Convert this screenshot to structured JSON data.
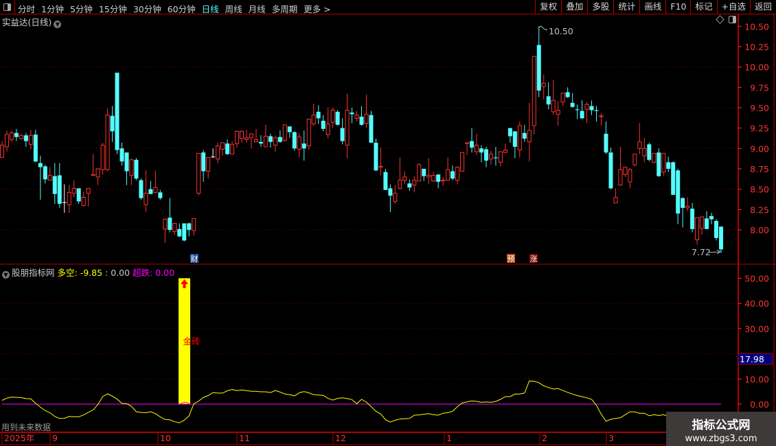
{
  "toolbar": {
    "periods": [
      "分时",
      "1分钟",
      "5分钟",
      "15分钟",
      "30分钟",
      "60分钟",
      "日线",
      "周线",
      "月线",
      "多周期",
      "更多 >"
    ],
    "active_period": "日线",
    "buttons": [
      "复权",
      "叠加",
      "多股",
      "统计",
      "画线",
      "F10",
      "标记",
      "+自选",
      "返回"
    ]
  },
  "main_pane": {
    "title": "实益达(日线)",
    "price_ticks": [
      "10.50",
      "10.25",
      "10.00",
      "9.75",
      "9.50",
      "9.25",
      "9.00",
      "8.75",
      "8.50",
      "8.25",
      "8.00"
    ],
    "high_label": "10.50",
    "low_label": "7.72",
    "markers": [
      {
        "text": "财",
        "color": "#1a4c9c"
      },
      {
        "text": "预",
        "color": "#c04a10"
      },
      {
        "text": "涨",
        "color": "#7a0000"
      }
    ]
  },
  "indicator_pane": {
    "name": "股朋指标网",
    "duokong_label": "多空",
    "duokong_value": ": -9.85",
    "duokong_value2": ": 0.00",
    "chaodie_label": "超跌",
    "chaodie_value": ": 0.00",
    "signal_label": "金砖",
    "signal_value": 50,
    "ticks": [
      "50.00",
      "40.00",
      "30.00",
      "10.00",
      "0.00"
    ],
    "current_value": "17.98",
    "future_data_note": "用到未来数据"
  },
  "date_axis": [
    "2025年",
    "9",
    "10",
    "11",
    "12",
    "1",
    "2",
    "3"
  ],
  "watermark": {
    "title": "指标公式网",
    "url": "www.zbgs3.com"
  },
  "colors": {
    "up": "#ff3232",
    "down": "#54fcfc",
    "line": "#ffff00",
    "zero": "#ff00ff",
    "signal": "#ffff00",
    "axis": "#ff3232",
    "grid": "#8b0000"
  },
  "chart_data": {
    "type": "candlestick",
    "fields": [
      "open",
      "high",
      "low",
      "close"
    ],
    "ylim": [
      7.72,
      10.5
    ],
    "candles": [
      [
        8.89,
        9.09,
        8.88,
        9.04
      ],
      [
        9.02,
        9.22,
        8.96,
        9.17
      ],
      [
        9.11,
        9.22,
        9.08,
        9.19
      ],
      [
        9.19,
        9.24,
        9.09,
        9.14
      ],
      [
        9.12,
        9.18,
        9.11,
        9.16
      ],
      [
        9.16,
        9.19,
        9.02,
        9.09
      ],
      [
        9.05,
        9.23,
        8.99,
        9.16
      ],
      [
        9.17,
        9.23,
        8.83,
        8.84
      ],
      [
        8.82,
        8.91,
        8.37,
        8.77
      ],
      [
        8.78,
        8.8,
        8.57,
        8.62
      ],
      [
        8.61,
        8.77,
        8.61,
        8.67
      ],
      [
        8.66,
        8.82,
        8.32,
        8.44
      ],
      [
        8.67,
        8.82,
        8.27,
        8.32
      ],
      [
        8.34,
        8.56,
        8.21,
        8.34
      ],
      [
        8.31,
        8.55,
        8.21,
        8.46
      ],
      [
        8.45,
        8.61,
        8.4,
        8.51
      ],
      [
        8.51,
        8.51,
        8.32,
        8.35
      ],
      [
        8.3,
        8.47,
        8.29,
        8.4
      ],
      [
        8.45,
        8.51,
        8.29,
        8.51
      ],
      [
        8.67,
        8.93,
        8.67,
        8.68
      ],
      [
        8.65,
        8.76,
        8.55,
        8.75
      ],
      [
        8.74,
        9.07,
        8.68,
        9.04
      ],
      [
        8.74,
        9.49,
        8.72,
        9.41
      ],
      [
        9.4,
        9.52,
        9.08,
        9.21
      ],
      [
        9.93,
        9.93,
        8.93,
        8.98
      ],
      [
        9.0,
        9.07,
        8.79,
        8.84
      ],
      [
        8.95,
        8.95,
        8.55,
        8.72
      ],
      [
        8.67,
        8.88,
        8.55,
        8.86
      ],
      [
        8.86,
        8.88,
        8.61,
        8.63
      ],
      [
        8.61,
        8.63,
        8.37,
        8.39
      ],
      [
        8.31,
        8.73,
        8.22,
        8.45
      ],
      [
        8.5,
        8.6,
        8.44,
        8.44
      ],
      [
        8.46,
        8.73,
        8.45,
        8.52
      ],
      [
        8.46,
        8.49,
        8.37,
        8.39
      ],
      [
        8.01,
        8.14,
        7.84,
        8.13
      ],
      [
        8.15,
        8.39,
        7.97,
        8.0
      ],
      [
        7.98,
        8.08,
        7.94,
        8.08
      ],
      [
        8.01,
        8.08,
        7.91,
        7.92
      ],
      [
        8.08,
        8.08,
        7.86,
        7.87
      ],
      [
        8.08,
        8.09,
        7.92,
        8.0
      ],
      [
        7.99,
        8.14,
        7.93,
        8.14
      ],
      [
        8.45,
        8.94,
        8.42,
        8.94
      ],
      [
        8.95,
        8.98,
        8.59,
        8.72
      ],
      [
        8.72,
        8.89,
        8.63,
        8.89
      ],
      [
        8.9,
        9.0,
        8.88,
        8.9
      ],
      [
        8.87,
        9.07,
        8.82,
        9.03
      ],
      [
        8.99,
        9.07,
        8.91,
        9.07
      ],
      [
        9.06,
        9.11,
        8.92,
        8.93
      ],
      [
        8.93,
        9.09,
        8.93,
        9.05
      ],
      [
        9.06,
        9.22,
        9.01,
        9.21
      ],
      [
        9.12,
        9.22,
        9.07,
        9.21
      ],
      [
        9.11,
        9.23,
        9.07,
        9.13
      ],
      [
        9.13,
        9.18,
        9.0,
        9.18
      ],
      [
        9.08,
        9.24,
        9.08,
        9.11
      ],
      [
        9.08,
        9.16,
        9.02,
        9.06
      ],
      [
        9.02,
        9.29,
        9.02,
        9.15
      ],
      [
        9.15,
        9.18,
        9.01,
        9.08
      ],
      [
        9.04,
        9.16,
        8.96,
        9.13
      ],
      [
        9.14,
        9.22,
        9.07,
        9.08
      ],
      [
        9.1,
        9.29,
        9.08,
        9.29
      ],
      [
        9.27,
        9.27,
        9.13,
        9.2
      ],
      [
        9.2,
        9.21,
        8.97,
        9.0
      ],
      [
        8.99,
        9.19,
        8.89,
        9.14
      ],
      [
        9.06,
        9.22,
        8.85,
        9.0
      ],
      [
        9.03,
        9.36,
        8.99,
        9.36
      ],
      [
        9.3,
        9.55,
        9.28,
        9.41
      ],
      [
        9.45,
        9.53,
        9.3,
        9.37
      ],
      [
        9.34,
        9.41,
        9.21,
        9.24
      ],
      [
        9.17,
        9.5,
        9.12,
        9.3
      ],
      [
        9.32,
        9.5,
        9.25,
        9.47
      ],
      [
        9.45,
        9.47,
        9.28,
        9.29
      ],
      [
        9.25,
        9.37,
        9.05,
        9.09
      ],
      [
        9.04,
        9.67,
        8.88,
        9.47
      ],
      [
        9.44,
        9.5,
        9.31,
        9.42
      ],
      [
        9.37,
        9.46,
        9.33,
        9.41
      ],
      [
        9.39,
        9.52,
        9.28,
        9.29
      ],
      [
        9.31,
        9.66,
        9.25,
        9.42
      ],
      [
        9.41,
        9.46,
        9.07,
        9.07
      ],
      [
        9.07,
        9.12,
        8.72,
        8.73
      ],
      [
        8.77,
        9.01,
        8.67,
        8.78
      ],
      [
        8.71,
        8.75,
        8.49,
        8.49
      ],
      [
        8.51,
        8.56,
        8.22,
        8.42
      ],
      [
        8.35,
        8.55,
        8.32,
        8.45
      ],
      [
        8.51,
        8.89,
        8.5,
        8.61
      ],
      [
        8.61,
        8.72,
        8.56,
        8.65
      ],
      [
        8.57,
        8.62,
        8.48,
        8.52
      ],
      [
        8.55,
        8.66,
        8.46,
        8.61
      ],
      [
        8.6,
        8.82,
        8.6,
        8.8
      ],
      [
        8.75,
        8.75,
        8.6,
        8.66
      ],
      [
        8.65,
        8.88,
        8.56,
        8.67
      ],
      [
        8.6,
        8.71,
        8.59,
        8.67
      ],
      [
        8.68,
        8.68,
        8.51,
        8.59
      ],
      [
        8.6,
        8.65,
        8.54,
        8.61
      ],
      [
        8.61,
        8.89,
        8.61,
        8.74
      ],
      [
        8.72,
        8.79,
        8.61,
        8.63
      ],
      [
        8.61,
        8.78,
        8.56,
        8.77
      ],
      [
        8.72,
        8.95,
        8.72,
        8.95
      ],
      [
        9.06,
        9.07,
        8.92,
        9.07
      ],
      [
        9.09,
        9.25,
        8.95,
        9.01
      ],
      [
        8.96,
        9.18,
        8.92,
        9.04
      ],
      [
        9.0,
        9.04,
        8.83,
        8.95
      ],
      [
        8.99,
        9.02,
        8.77,
        8.85
      ],
      [
        8.87,
        8.97,
        8.8,
        8.93
      ],
      [
        8.89,
        9.02,
        8.79,
        8.88
      ],
      [
        8.83,
        8.96,
        8.78,
        8.96
      ],
      [
        8.95,
        9.06,
        8.95,
        8.98
      ],
      [
        9.25,
        9.25,
        9.07,
        9.15
      ],
      [
        9.21,
        9.21,
        8.88,
        9.02
      ],
      [
        8.98,
        9.33,
        8.89,
        9.28
      ],
      [
        9.19,
        9.29,
        9.08,
        9.12
      ],
      [
        9.08,
        9.56,
        8.84,
        9.22
      ],
      [
        9.28,
        10.13,
        9.17,
        10.13
      ],
      [
        10.27,
        10.5,
        9.63,
        9.71
      ],
      [
        9.76,
        9.91,
        9.6,
        9.8
      ],
      [
        9.64,
        9.81,
        9.48,
        9.54
      ],
      [
        9.45,
        9.84,
        9.41,
        9.59
      ],
      [
        9.42,
        9.58,
        9.28,
        9.47
      ],
      [
        9.57,
        9.68,
        9.52,
        9.68
      ],
      [
        9.69,
        9.75,
        9.62,
        9.63
      ],
      [
        9.56,
        9.68,
        9.5,
        9.51
      ],
      [
        9.48,
        9.54,
        9.36,
        9.47
      ],
      [
        9.46,
        9.59,
        9.36,
        9.37
      ],
      [
        9.48,
        9.57,
        9.31,
        9.54
      ],
      [
        9.52,
        9.59,
        9.41,
        9.47
      ],
      [
        9.47,
        9.52,
        9.33,
        9.46
      ],
      [
        9.39,
        9.43,
        9.28,
        9.4
      ],
      [
        9.18,
        9.33,
        8.93,
        8.95
      ],
      [
        8.95,
        9.01,
        8.5,
        8.51
      ],
      [
        8.33,
        8.51,
        8.33,
        8.4
      ],
      [
        8.55,
        9.02,
        8.54,
        8.74
      ],
      [
        8.68,
        8.77,
        8.65,
        8.77
      ],
      [
        8.59,
        8.76,
        8.51,
        8.74
      ],
      [
        8.8,
        8.93,
        8.78,
        8.93
      ],
      [
        9.0,
        9.31,
        8.93,
        9.08
      ],
      [
        8.91,
        9.13,
        8.83,
        9.0
      ],
      [
        9.05,
        9.07,
        8.84,
        8.86
      ],
      [
        8.83,
        8.94,
        8.82,
        8.94
      ],
      [
        8.95,
        9.0,
        8.65,
        8.66
      ],
      [
        8.71,
        8.94,
        8.66,
        8.94
      ],
      [
        8.83,
        8.9,
        8.71,
        8.75
      ],
      [
        8.83,
        8.84,
        8.43,
        8.43
      ],
      [
        8.73,
        8.75,
        8.07,
        8.2
      ],
      [
        8.39,
        8.4,
        8.03,
        8.27
      ],
      [
        8.27,
        8.4,
        8.23,
        8.29
      ],
      [
        8.26,
        8.33,
        7.97,
        8.01
      ],
      [
        7.88,
        8.15,
        7.82,
        8.15
      ],
      [
        8.02,
        8.16,
        7.94,
        8.16
      ],
      [
        8.14,
        8.23,
        8.01,
        8.01
      ],
      [
        8.17,
        8.21,
        8.07,
        8.13
      ],
      [
        8.11,
        8.13,
        7.87,
        7.9
      ],
      [
        8.04,
        8.04,
        7.72,
        7.76
      ]
    ],
    "indicator": {
      "ylim": [
        -10,
        50
      ],
      "duokong": [
        1.5,
        2.4,
        2.8,
        2.7,
        2.6,
        2.2,
        2.1,
        0.3,
        -1.2,
        -2.6,
        -3.4,
        -4.9,
        -5.7,
        -5.6,
        -4.9,
        -5.0,
        -5.0,
        -4.3,
        -3.3,
        -2.3,
        -0.2,
        3.0,
        4.1,
        3.2,
        2.0,
        0.3,
        0.2,
        -0.9,
        -3.0,
        -3.3,
        -3.4,
        -3.0,
        -3.8,
        -5.0,
        -6.1,
        -6.2,
        -7.0,
        -7.4,
        -6.4,
        -4.7,
        0.1,
        1.2,
        2.7,
        3.4,
        4.6,
        4.4,
        4.4,
        5.3,
        5.8,
        5.4,
        5.6,
        5.4,
        5.1,
        5.1,
        4.9,
        4.9,
        4.6,
        5.4,
        4.8,
        4.0,
        3.8,
        3.3,
        4.5,
        5.0,
        4.5,
        3.8,
        3.6,
        3.5,
        2.3,
        1.6,
        2.3,
        2.5,
        2.2,
        1.8,
        0.2,
        1.9,
        0.8,
        -1.0,
        -2.8,
        -3.9,
        -6.2,
        -7.1,
        -6.4,
        -5.9,
        -5.8,
        -5.7,
        -4.4,
        -4.3,
        -4.0,
        -3.8,
        -4.2,
        -4.4,
        -3.6,
        -3.4,
        -2.8,
        -1.0,
        0.5,
        0.9,
        1.3,
        1.1,
        0.7,
        0.9,
        0.7,
        1.1,
        1.9,
        3.0,
        3.0,
        4.0,
        4.0,
        4.4,
        9.2,
        9.1,
        8.5,
        7.3,
        6.6,
        6.0,
        6.2,
        5.4,
        4.7,
        4.0,
        3.4,
        3.0,
        2.5,
        1.9,
        -0.5,
        -4.0,
        -6.8,
        -6.0,
        -5.7,
        -5.4,
        -4.2,
        -3.0,
        -3.1,
        -3.6,
        -3.6,
        -4.6,
        -4.2,
        -4.5,
        -4.2,
        -4.8,
        -5.0,
        -5.5,
        -6.0,
        -6.2,
        -6.5,
        -7.0,
        -7.2,
        -7.5,
        -8.0,
        -8.3,
        -8.5
      ]
    }
  }
}
